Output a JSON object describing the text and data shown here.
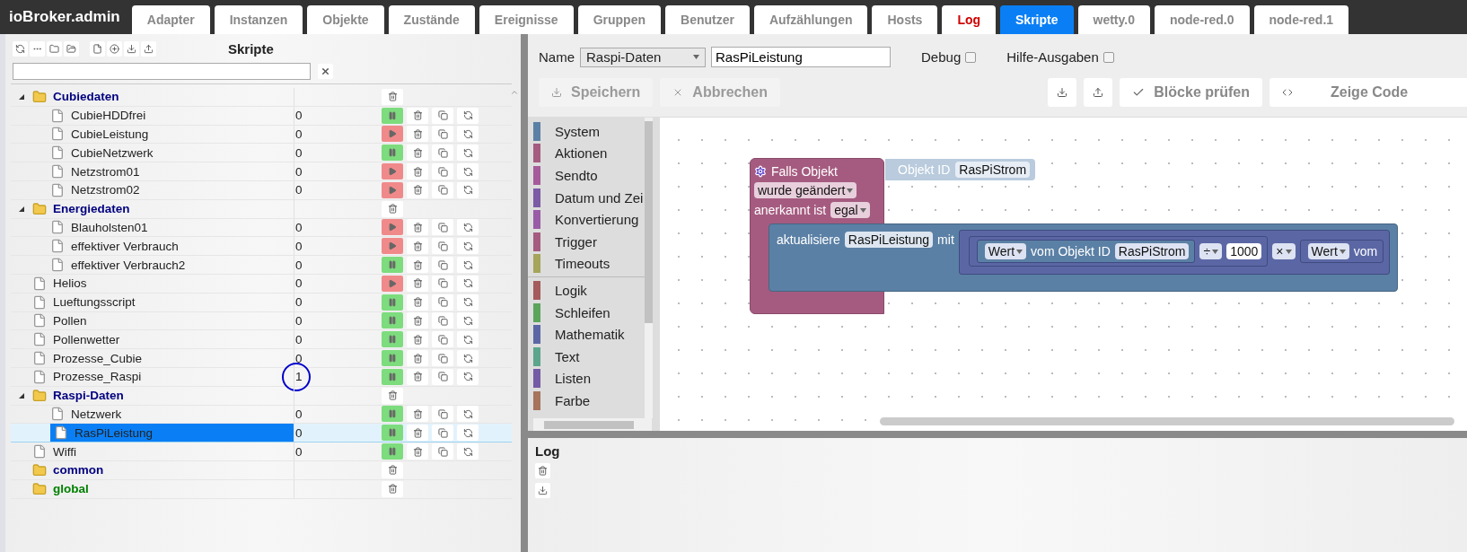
{
  "brand": "ioBroker.admin",
  "tabs": [
    {
      "label": "Adapter",
      "selected": false,
      "alert": false
    },
    {
      "label": "Instanzen",
      "selected": false,
      "alert": false
    },
    {
      "label": "Objekte",
      "selected": false,
      "alert": false
    },
    {
      "label": "Zustände",
      "selected": false,
      "alert": false
    },
    {
      "label": "Ereignisse",
      "selected": false,
      "alert": false
    },
    {
      "label": "Gruppen",
      "selected": false,
      "alert": false
    },
    {
      "label": "Benutzer",
      "selected": false,
      "alert": false
    },
    {
      "label": "Aufzählungen",
      "selected": false,
      "alert": false
    },
    {
      "label": "Hosts",
      "selected": false,
      "alert": false
    },
    {
      "label": "Log",
      "selected": false,
      "alert": true
    },
    {
      "label": "Skripte",
      "selected": true,
      "alert": false
    },
    {
      "label": "wetty.0",
      "selected": false,
      "alert": false
    },
    {
      "label": "node-red.0",
      "selected": false,
      "alert": false
    },
    {
      "label": "node-red.1",
      "selected": false,
      "alert": false
    }
  ],
  "sidebar": {
    "title": "Skripte",
    "tree": [
      {
        "kind": "folder",
        "name": "Cubiedaten",
        "color": "#000080",
        "expanded": true,
        "selected": false,
        "children": [
          {
            "kind": "script",
            "name": "CubieHDDfrei",
            "count": "0",
            "running": true,
            "selected": false,
            "circled": false
          },
          {
            "kind": "script",
            "name": "CubieLeistung",
            "count": "0",
            "running": false,
            "selected": false,
            "circled": false
          },
          {
            "kind": "script",
            "name": "CubieNetzwerk",
            "count": "0",
            "running": true,
            "selected": false,
            "circled": false
          },
          {
            "kind": "script",
            "name": "Netzstrom01",
            "count": "0",
            "running": false,
            "selected": false,
            "circled": false
          },
          {
            "kind": "script",
            "name": "Netzstrom02",
            "count": "0",
            "running": false,
            "selected": false,
            "circled": false
          }
        ]
      },
      {
        "kind": "folder",
        "name": "Energiedaten",
        "color": "#000080",
        "expanded": true,
        "selected": false,
        "children": [
          {
            "kind": "script",
            "name": "Blauholsten01",
            "count": "0",
            "running": false,
            "selected": false,
            "circled": false
          },
          {
            "kind": "script",
            "name": "effektiver Verbrauch",
            "count": "0",
            "running": false,
            "selected": false,
            "circled": false
          },
          {
            "kind": "script",
            "name": "effektiver Verbrauch2",
            "count": "0",
            "running": true,
            "selected": false,
            "circled": false
          }
        ]
      },
      {
        "kind": "script",
        "name": "Helios",
        "count": "0",
        "running": false,
        "selected": false,
        "circled": false
      },
      {
        "kind": "script",
        "name": "Lueftungsscript",
        "count": "0",
        "running": true,
        "selected": false,
        "circled": false
      },
      {
        "kind": "script",
        "name": "Pollen",
        "count": "0",
        "running": true,
        "selected": false,
        "circled": false
      },
      {
        "kind": "script",
        "name": "Pollenwetter",
        "count": "0",
        "running": true,
        "selected": false,
        "circled": false
      },
      {
        "kind": "script",
        "name": "Prozesse_Cubie",
        "count": "0",
        "running": true,
        "selected": false,
        "circled": false
      },
      {
        "kind": "script",
        "name": "Prozesse_Raspi",
        "count": "1",
        "running": true,
        "selected": false,
        "circled": true
      },
      {
        "kind": "folder",
        "name": "Raspi-Daten",
        "color": "#000080",
        "expanded": true,
        "selected": false,
        "children": [
          {
            "kind": "script",
            "name": "Netzwerk",
            "count": "0",
            "running": true,
            "selected": false,
            "circled": false
          },
          {
            "kind": "script",
            "name": "RasPiLeistung",
            "count": "0",
            "running": true,
            "selected": true,
            "circled": false
          }
        ]
      },
      {
        "kind": "script",
        "name": "Wiffi",
        "count": "0",
        "running": true,
        "selected": false,
        "circled": false
      },
      {
        "kind": "folder",
        "name": "common",
        "color": "#000080",
        "selected": false
      },
      {
        "kind": "folder",
        "name": "global",
        "color": "#008000",
        "selected": false
      }
    ]
  },
  "editor": {
    "name_label": "Name",
    "group": "Raspi-Daten",
    "name_value": "RasPiLeistung",
    "options": [
      {
        "label": "Debug",
        "checked": false
      },
      {
        "label": "Hilfe-Ausgaben",
        "checked": false
      }
    ],
    "buttons": [
      {
        "label": "Speichern",
        "disabled": true
      },
      {
        "label": "Abbrechen",
        "disabled": true
      }
    ],
    "check_button": "Blöcke prüfen",
    "code_button": "Zeige Code"
  },
  "toolbox": {
    "groups": [
      {
        "categories": [
          {
            "label": "System",
            "color": "#5b80a5"
          },
          {
            "label": "Aktionen",
            "color": "#a55b80"
          },
          {
            "label": "Sendto",
            "color": "#a55b99"
          },
          {
            "label": "Datum und Zei",
            "color": "#7b5ba5"
          },
          {
            "label": "Konvertierung",
            "color": "#995ba5"
          },
          {
            "label": "Trigger",
            "color": "#a55b80"
          },
          {
            "label": "Timeouts",
            "color": "#a5a55b"
          }
        ]
      },
      {
        "categories": [
          {
            "label": "Logik",
            "color": "#a55b5b"
          },
          {
            "label": "Schleifen",
            "color": "#5ba55b"
          },
          {
            "label": "Mathematik",
            "color": "#5b67a5"
          },
          {
            "label": "Text",
            "color": "#5ba58c"
          },
          {
            "label": "Listen",
            "color": "#745ba5"
          },
          {
            "label": "Farbe",
            "color": "#a5745b"
          }
        ]
      }
    ]
  },
  "workspace": {
    "event": {
      "title": "Falls Objekt",
      "object_label": "Objekt ID",
      "object_value": "RasPiStrom",
      "trigger": "wurde geändert",
      "ack_label": "anerkannt ist",
      "ack_value": "egal",
      "action": {
        "label": "aktualisiere",
        "target": "RasPiLeistung",
        "connector": "mit",
        "expression": {
          "kind": "block",
          "tokens": [
            {
              "kind": "block",
              "tokens": [
                {
                  "kind": "block",
                  "tokens": [
                    {
                      "kind": "dropdown",
                      "text": "Wert"
                    },
                    {
                      "kind": "label",
                      "text": "vom Objekt ID"
                    },
                    {
                      "kind": "field",
                      "text": "RasPiStrom"
                    }
                  ]
                },
                {
                  "kind": "dropdown",
                  "text": "÷"
                },
                {
                  "kind": "number",
                  "text": "1000"
                }
              ]
            },
            {
              "kind": "dropdown",
              "text": "×"
            },
            {
              "kind": "block",
              "tokens": [
                {
                  "kind": "dropdown",
                  "text": "Wert"
                },
                {
                  "kind": "label",
                  "text": "vom"
                }
              ]
            }
          ]
        }
      }
    }
  },
  "log": {
    "title": "Log"
  }
}
